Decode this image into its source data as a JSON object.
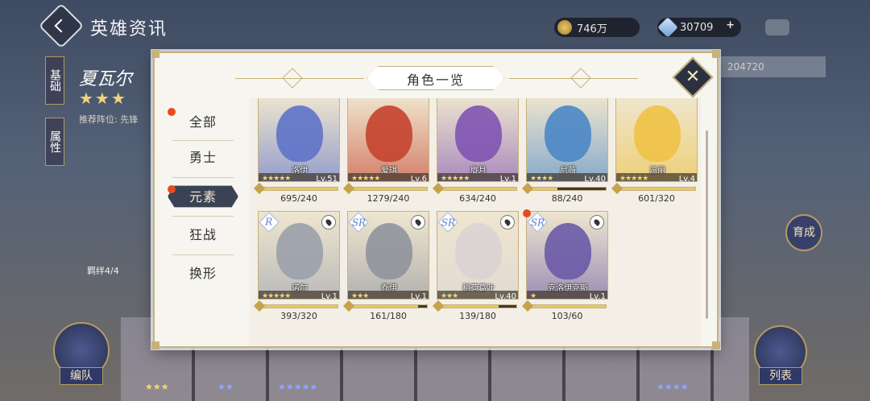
{
  "header": {
    "title": "英雄资讯"
  },
  "currency": {
    "gold": "746万",
    "gems": "30709",
    "gems_plus": "+"
  },
  "hero": {
    "name": "夏瓦尔",
    "stars": "★★★",
    "position": "推荐阵位: 先锋",
    "bond": "羁绊4/4",
    "id_text": "204720"
  },
  "side_tabs": [
    "基础",
    "属性"
  ],
  "buttons": {
    "team": "编队",
    "list": "列表",
    "grow": "育成"
  },
  "modal": {
    "title": "角色一览",
    "close": "✕",
    "filters": [
      "全部",
      "勇士",
      "元素",
      "狂战",
      "换形"
    ],
    "active_filter": "元素"
  },
  "cards": [
    {
      "name": "洛伊",
      "stars": "★★★★★",
      "level": "Lv.51",
      "fragments": "695/240",
      "fill": 1.0,
      "art": "#5e73c9"
    },
    {
      "name": "爱琪",
      "stars": "★★★★★",
      "level": "Lv.6",
      "fragments": "1279/240",
      "fill": 1.0,
      "art": "#c5432e"
    },
    {
      "name": "胧月",
      "stars": "★★★★★",
      "level": "Lv.1",
      "fragments": "634/240",
      "fill": 1.0,
      "art": "#8054b3"
    },
    {
      "name": "尼薇",
      "stars": "★★★★",
      "level": "Lv.40",
      "fragments": "88/240",
      "fill": 0.37,
      "art": "#4b87c6"
    },
    {
      "name": "温丽",
      "stars": "★★★★★",
      "level": "Lv.4",
      "fragments": "601/320",
      "fill": 1.0,
      "art": "#eec247"
    },
    {
      "name": "诺尔",
      "stars": "★★★★★",
      "level": "Lv.1",
      "fragments": "393/320",
      "fill": 1.0,
      "art": "#9aa0ab",
      "rarity": "R"
    },
    {
      "name": "乔伊",
      "stars": "★★★",
      "level": "Lv.1",
      "fragments": "161/180",
      "fill": 0.89,
      "art": "#8f939c",
      "rarity": "SR"
    },
    {
      "name": "稻荷葛叶",
      "stars": "★★★",
      "level": "Lv.40",
      "fragments": "139/180",
      "fill": 0.77,
      "art": "#d9d3d3",
      "rarity": "SR"
    },
    {
      "name": "克洛伊克斯",
      "stars": "★",
      "level": "Lv.1",
      "fragments": "103/60",
      "fill": 1.0,
      "art": "#6a5aa6",
      "rarity": "SR"
    }
  ],
  "colors": {
    "accent_gold": "#c7b27d",
    "active_filter_bg": "#3a4256",
    "notify_dot": "#e84a1e"
  }
}
